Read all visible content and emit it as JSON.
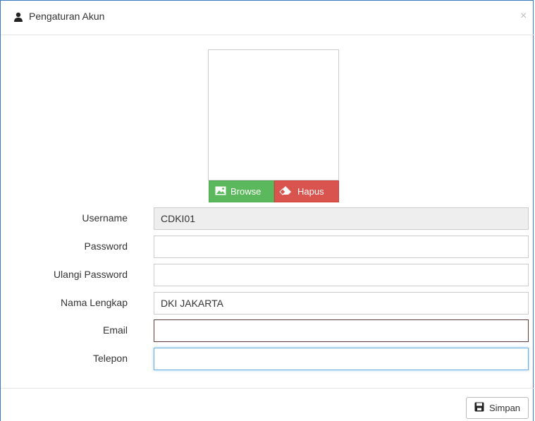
{
  "header": {
    "title": "Pengaturan Akun",
    "close_glyph": "×",
    "icon": "user-icon"
  },
  "photo": {
    "browse_label": "Browse",
    "browse_icon": "image-icon",
    "hapus_label": "Hapus",
    "hapus_icon": "eraser-icon"
  },
  "form": {
    "username": {
      "label": "Username",
      "value": "CDKI01"
    },
    "password": {
      "label": "Password",
      "value": ""
    },
    "ulangi_password": {
      "label": "Ulangi Password",
      "value": ""
    },
    "nama_lengkap": {
      "label": "Nama Lengkap",
      "value": "DKI JAKARTA"
    },
    "email": {
      "label": "Email",
      "value": ""
    },
    "telepon": {
      "label": "Telepon",
      "value": ""
    }
  },
  "footer": {
    "save_label": "Simpan",
    "save_icon": "save-icon"
  },
  "colors": {
    "browse": "#5cb85c",
    "hapus": "#d9534f",
    "modal_border": "#3b7bc4",
    "focus": "#66afe9"
  }
}
